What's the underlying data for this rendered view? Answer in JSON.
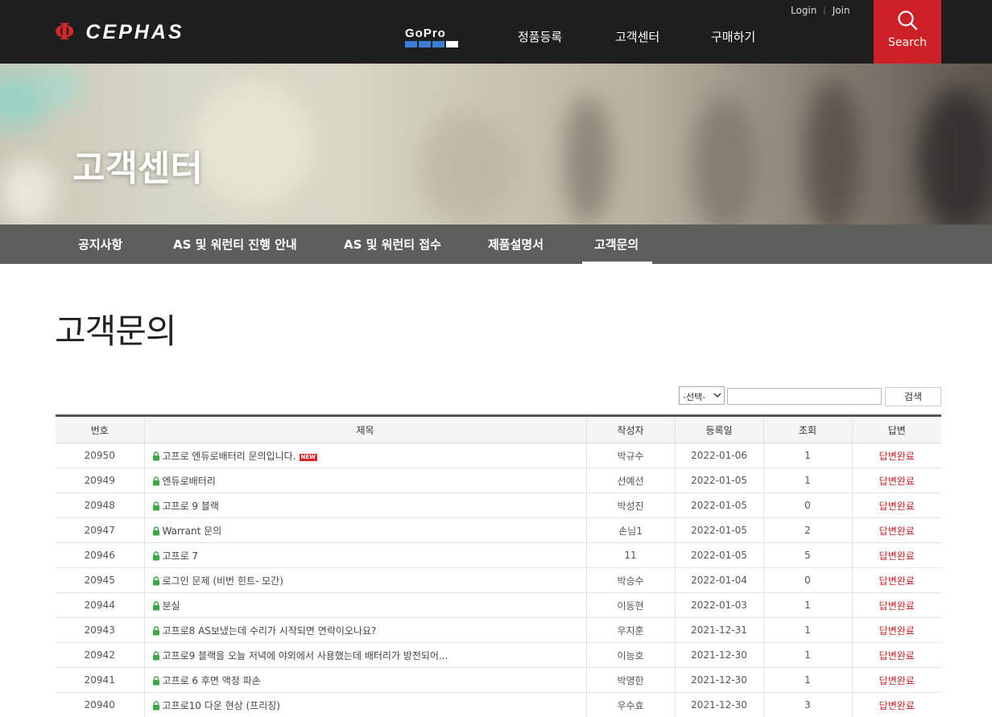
{
  "header": {
    "logo_symbol": "Φ",
    "logo_text": "CEPHAS",
    "gopro_label": "GoPro",
    "nav": [
      "정품등록",
      "고객센터",
      "구매하기"
    ],
    "login": "Login",
    "join": "Join",
    "search_label": "Search",
    "accent_color": "#cd2027"
  },
  "banner": {
    "title": "고객센터"
  },
  "subnav": {
    "items": [
      "공지사항",
      "AS 및 워런티 진행 안내",
      "AS 및 워런티 접수",
      "제품설명서",
      "고객문의"
    ],
    "active": "고객문의"
  },
  "page": {
    "title": "고객문의"
  },
  "search": {
    "filter_selected": "-선택-",
    "button": "검색",
    "query": ""
  },
  "table": {
    "headers": [
      "번호",
      "제목",
      "작성자",
      "등록일",
      "조회",
      "답변"
    ],
    "new_badge": "NEW",
    "rows": [
      {
        "no": "20950",
        "subject": "고프로 엔듀로배터리 문의입니다.",
        "author": "박규수",
        "date": "2022-01-06",
        "views": "1",
        "status": "답변완료",
        "new": true
      },
      {
        "no": "20949",
        "subject": "엔듀로배터리",
        "author": "선예선",
        "date": "2022-01-05",
        "views": "1",
        "status": "답변완료"
      },
      {
        "no": "20948",
        "subject": "고프로 9 블랙",
        "author": "박성진",
        "date": "2022-01-05",
        "views": "0",
        "status": "답변완료"
      },
      {
        "no": "20947",
        "subject": "Warrant 문의",
        "author": "손님1",
        "date": "2022-01-05",
        "views": "2",
        "status": "답변완료"
      },
      {
        "no": "20946",
        "subject": "고프로 7",
        "author": "11",
        "date": "2022-01-05",
        "views": "5",
        "status": "답변완료"
      },
      {
        "no": "20945",
        "subject": "로그인 문제 (비번 힌트- 모간)",
        "author": "박승수",
        "date": "2022-01-04",
        "views": "0",
        "status": "답변완료"
      },
      {
        "no": "20944",
        "subject": "분실",
        "author": "이동현",
        "date": "2022-01-03",
        "views": "1",
        "status": "답변완료"
      },
      {
        "no": "20943",
        "subject": "고프로8 AS보냈는데 수리가 시작되면 연락이오나요?",
        "author": "우지훈",
        "date": "2021-12-31",
        "views": "1",
        "status": "답변완료"
      },
      {
        "no": "20942",
        "subject": "고프로9 블랙을 오늘 저녁에 야외에서 사용했는데 배터리가 방전되어...",
        "author": "이능호",
        "date": "2021-12-30",
        "views": "1",
        "status": "답변완료"
      },
      {
        "no": "20941",
        "subject": "고프로 6 후면 액정 파손",
        "author": "박명한",
        "date": "2021-12-30",
        "views": "1",
        "status": "답변완료"
      },
      {
        "no": "20940",
        "subject": "고프로10 다운 현상 (프리징)",
        "author": "우수효",
        "date": "2021-12-30",
        "views": "3",
        "status": "답변완료"
      }
    ]
  }
}
